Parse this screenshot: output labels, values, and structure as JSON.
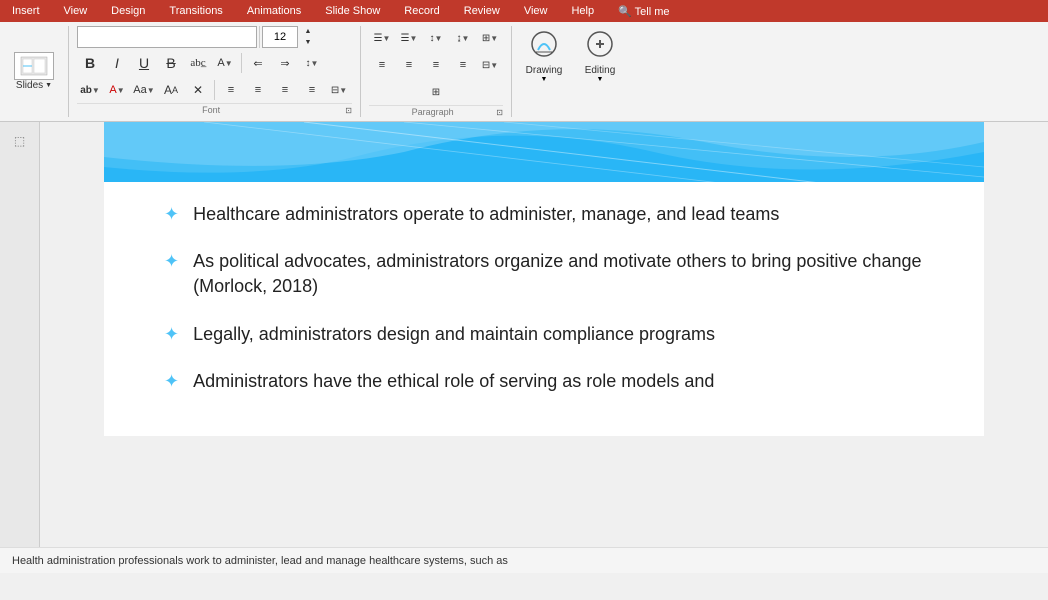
{
  "ribbon": {
    "tabs": [
      "Insert",
      "View",
      "Design",
      "Transitions",
      "Animations",
      "Slide Show",
      "Record",
      "Review",
      "View",
      "Help",
      "Tell me"
    ]
  },
  "toolbar": {
    "slides_label": "Slides",
    "font_name": "",
    "font_size": "12",
    "font_size_arrow_up": "▲",
    "font_size_arrow_down": "▼",
    "bold": "B",
    "italic": "I",
    "underline": "U",
    "strikethrough": "S",
    "strikethrough_sym": "ab̶c̶",
    "font_section_label": "Font",
    "paragraph_section_label": "Paragraph",
    "drawing_label": "Drawing",
    "editing_label": "Editing"
  },
  "slide": {
    "bullets": [
      "Healthcare administrators operate to administer, manage, and lead teams",
      "As political advocates, administrators organize and motivate others to bring positive change (Morlock, 2018)",
      "Legally, administrators design and maintain compliance programs",
      "Administrators have the ethical role of serving as role models and"
    ]
  },
  "status_bar": {
    "text": "Health administration professionals work to administer, lead and manage healthcare systems, such as"
  }
}
